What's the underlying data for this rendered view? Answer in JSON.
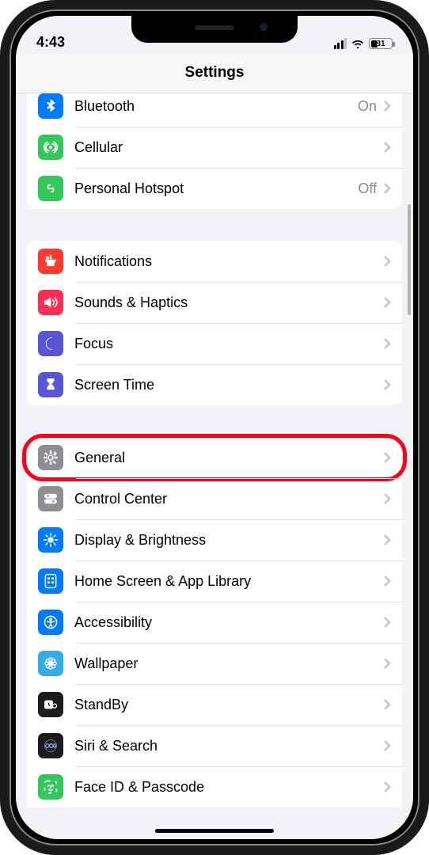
{
  "status": {
    "time": "4:43",
    "battery_pct": "31"
  },
  "header": {
    "title": "Settings"
  },
  "groups": [
    {
      "id": "connectivity",
      "items": [
        {
          "id": "bluetooth",
          "label": "Bluetooth",
          "value": "On",
          "icon": "bluetooth-icon",
          "color": "c-blue"
        },
        {
          "id": "cellular",
          "label": "Cellular",
          "value": "",
          "icon": "antenna-icon",
          "color": "c-green"
        },
        {
          "id": "hotspot",
          "label": "Personal Hotspot",
          "value": "Off",
          "icon": "link-icon",
          "color": "c-green"
        }
      ]
    },
    {
      "id": "alerts",
      "items": [
        {
          "id": "notifications",
          "label": "Notifications",
          "value": "",
          "icon": "bell-icon",
          "color": "c-red"
        },
        {
          "id": "sounds",
          "label": "Sounds & Haptics",
          "value": "",
          "icon": "speaker-icon",
          "color": "c-pink"
        },
        {
          "id": "focus",
          "label": "Focus",
          "value": "",
          "icon": "moon-icon",
          "color": "c-indigo"
        },
        {
          "id": "screentime",
          "label": "Screen Time",
          "value": "",
          "icon": "hourglass-icon",
          "color": "c-indigo"
        }
      ]
    },
    {
      "id": "system",
      "items": [
        {
          "id": "general",
          "label": "General",
          "value": "",
          "icon": "gear-icon",
          "color": "c-grey",
          "highlight": true
        },
        {
          "id": "controlcenter",
          "label": "Control Center",
          "value": "",
          "icon": "switches-icon",
          "color": "c-grey"
        },
        {
          "id": "display",
          "label": "Display & Brightness",
          "value": "",
          "icon": "sun-icon",
          "color": "c-blue"
        },
        {
          "id": "homescreen",
          "label": "Home Screen & App Library",
          "value": "",
          "icon": "grid-icon",
          "color": "c-blue"
        },
        {
          "id": "accessibility",
          "label": "Accessibility",
          "value": "",
          "icon": "accessibility-icon",
          "color": "c-blue"
        },
        {
          "id": "wallpaper",
          "label": "Wallpaper",
          "value": "",
          "icon": "flower-icon",
          "color": "c-teal"
        },
        {
          "id": "standby",
          "label": "StandBy",
          "value": "",
          "icon": "clock-icon",
          "color": "c-black"
        },
        {
          "id": "siri",
          "label": "Siri & Search",
          "value": "",
          "icon": "siri-icon",
          "color": "c-black"
        },
        {
          "id": "faceid",
          "label": "Face ID & Passcode",
          "value": "",
          "icon": "faceid-icon",
          "color": "c-green"
        }
      ]
    }
  ],
  "annotation": {
    "highlight_target": "general"
  }
}
